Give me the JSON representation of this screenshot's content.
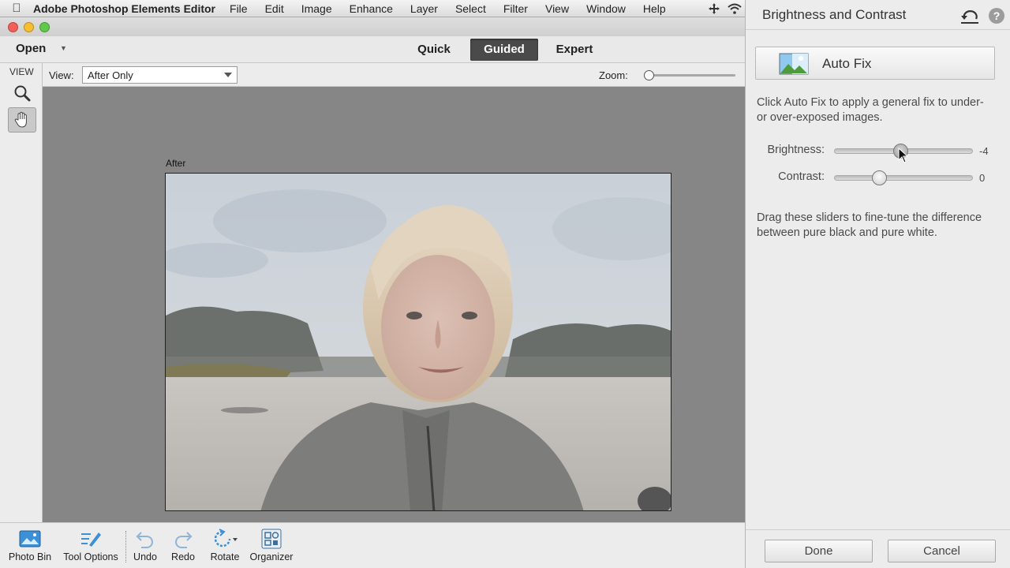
{
  "menubar": {
    "app_name": "Adobe Photoshop Elements Editor",
    "menus": [
      "File",
      "Edit",
      "Image",
      "Enhance",
      "Layer",
      "Select",
      "Filter",
      "View",
      "Window",
      "Help"
    ],
    "tray_icons": [
      "move-arrows-icon",
      "wifi-icon"
    ]
  },
  "modebar": {
    "open_label": "Open",
    "tabs": [
      "Quick",
      "Guided",
      "Expert"
    ],
    "active_tab": "Guided"
  },
  "viewbar": {
    "view_label": "View:",
    "view_value": "After Only",
    "zoom_label": "Zoom:",
    "zoom_level": 0.0
  },
  "toolpanel": {
    "heading": "VIEW",
    "tools": [
      "zoom-tool-icon",
      "hand-tool-icon"
    ],
    "active_tool": "hand-tool-icon"
  },
  "canvas": {
    "image_label": "After",
    "background": "#868686"
  },
  "bottombar": {
    "photo_bin": "Photo Bin",
    "tool_options": "Tool Options",
    "undo": "Undo",
    "redo": "Redo",
    "rotate": "Rotate",
    "organizer": "Organizer"
  },
  "panel": {
    "title": "Brightness and Contrast",
    "auto_fix_label": "Auto Fix",
    "auto_fix_description": "Click Auto Fix to apply a general fix to under- or over-exposed images.",
    "brightness_label": "Brightness:",
    "brightness_value": "-4",
    "contrast_label": "Contrast:",
    "contrast_value": "0",
    "sliders_description": "Drag these sliders to fine-tune the difference between pure black and pure white.",
    "done_label": "Done",
    "cancel_label": "Cancel"
  },
  "colors": {
    "accent_active_tab": "#4a4a4a",
    "panel_bg": "#ececec",
    "canvas_bg": "#868686"
  }
}
